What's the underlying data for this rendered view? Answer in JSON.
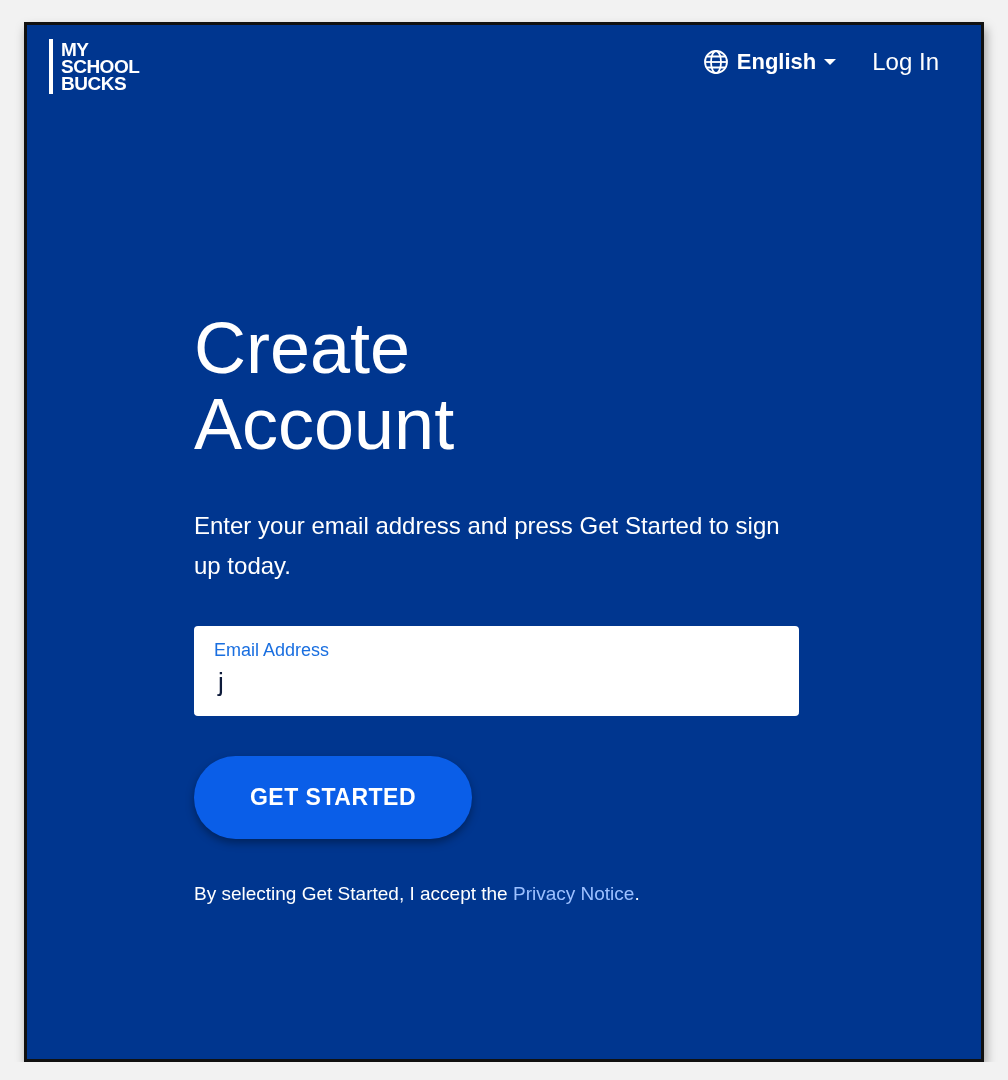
{
  "header": {
    "logo": [
      "MY",
      "SCHOOL",
      "BUCKS"
    ],
    "language": "English",
    "login": "Log In"
  },
  "main": {
    "title_lines": [
      "Create",
      "Account"
    ],
    "intro": "Enter your email address and press Get Started to sign up today.",
    "email_field": {
      "label": "Email Address",
      "value": "j",
      "focused": true
    },
    "button": "GET STARTED",
    "notice": {
      "text": "By selecting Get Started, I accept the ",
      "link": "Privacy Notice",
      "end": "."
    }
  }
}
